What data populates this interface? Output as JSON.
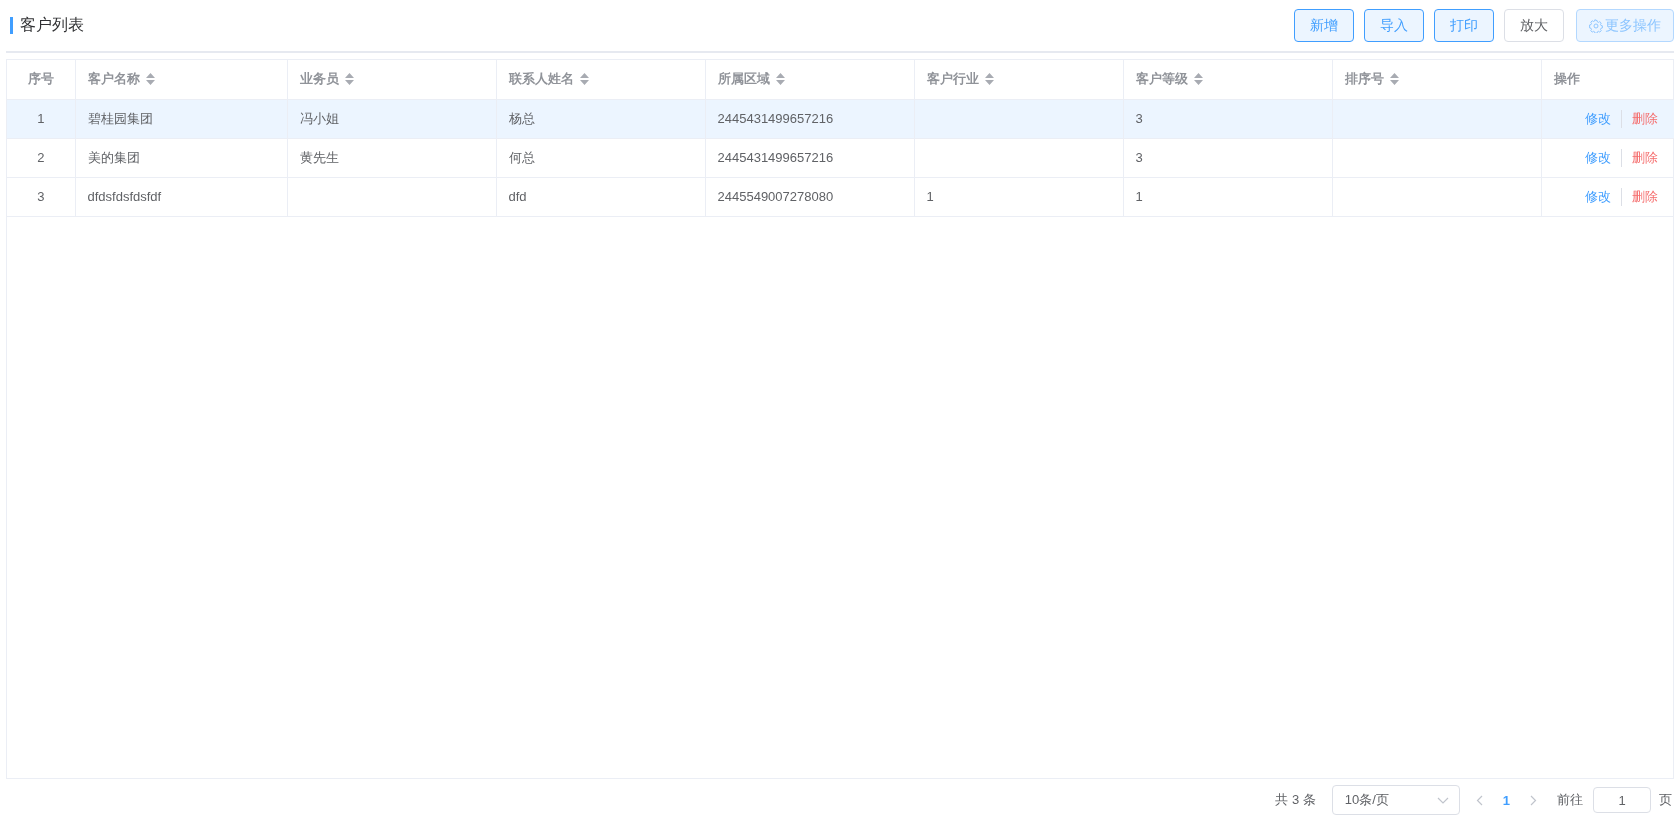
{
  "title": "客户列表",
  "toolbar": [
    {
      "label": "新增",
      "kind": "primary"
    },
    {
      "label": "导入",
      "kind": "primary"
    },
    {
      "label": "打印",
      "kind": "primary"
    },
    {
      "label": "放大",
      "kind": "default"
    },
    {
      "label": "更多操作",
      "kind": "more"
    }
  ],
  "table": {
    "columns": [
      {
        "label": "序号",
        "sortable": false
      },
      {
        "label": "客户名称",
        "sortable": true
      },
      {
        "label": "业务员",
        "sortable": true
      },
      {
        "label": "联系人姓名",
        "sortable": true
      },
      {
        "label": "所属区域",
        "sortable": true
      },
      {
        "label": "客户行业",
        "sortable": true
      },
      {
        "label": "客户等级",
        "sortable": true
      },
      {
        "label": "排序号",
        "sortable": true
      },
      {
        "label": "操作",
        "sortable": false
      }
    ],
    "rows": [
      {
        "selected": true,
        "cells": [
          "1",
          "碧桂园集团",
          "冯小姐",
          "杨总",
          "2445431499657216",
          "",
          "3",
          ""
        ],
        "actions": [
          {
            "label": "修改",
            "kind": "edit"
          },
          {
            "label": "删除",
            "kind": "delete"
          }
        ]
      },
      {
        "selected": false,
        "cells": [
          "2",
          "美的集团",
          "黄先生",
          "何总",
          "2445431499657216",
          "",
          "3",
          ""
        ],
        "actions": [
          {
            "label": "修改",
            "kind": "edit"
          },
          {
            "label": "删除",
            "kind": "delete"
          }
        ]
      },
      {
        "selected": false,
        "cells": [
          "3",
          "dfdsfdsfdsfdf",
          "",
          "dfd",
          "2445549007278080",
          "1",
          "1",
          ""
        ],
        "actions": [
          {
            "label": "修改",
            "kind": "edit"
          },
          {
            "label": "删除",
            "kind": "delete"
          }
        ]
      }
    ]
  },
  "pagination": {
    "total": "共 3 条",
    "page_size": "10条/页",
    "pages": [
      {
        "label": "1",
        "selected": true
      }
    ],
    "goto_label": "前往",
    "goto_value": "1",
    "goto_suffix": "页"
  }
}
